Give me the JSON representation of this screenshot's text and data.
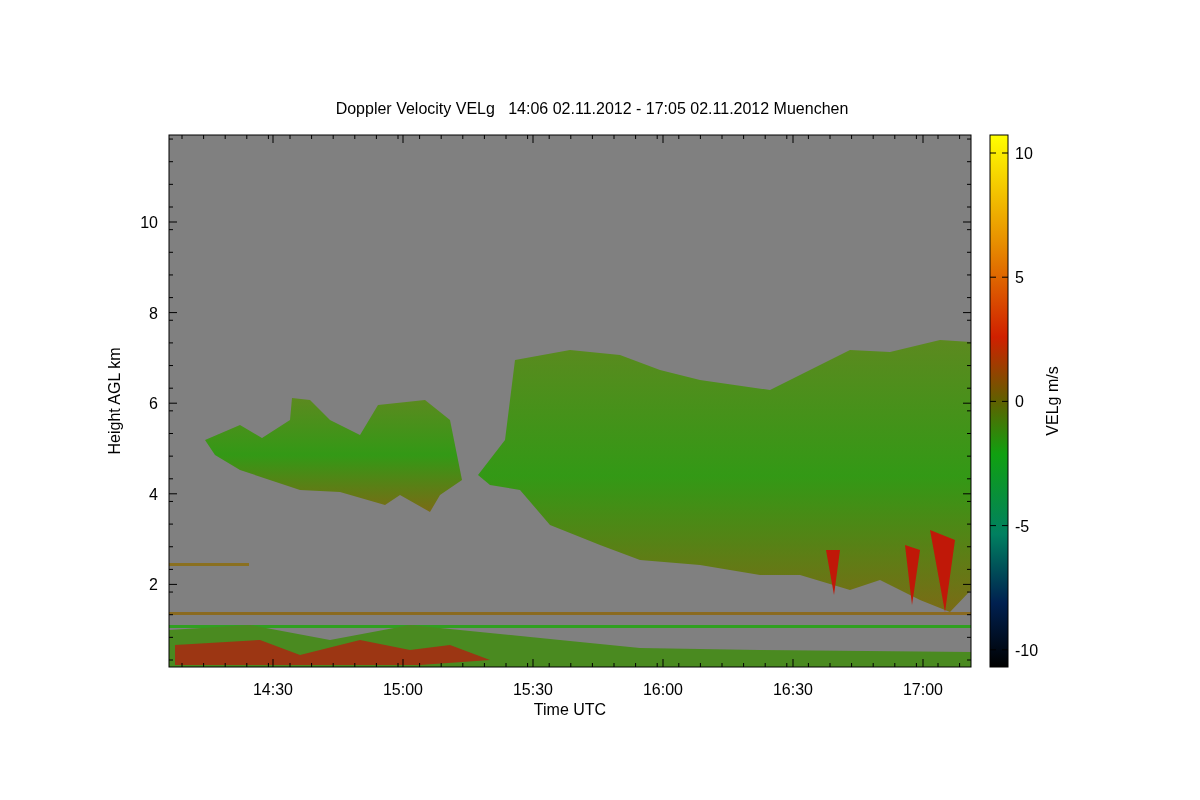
{
  "plot": {
    "title": "Doppler Velocity VELg   14:06 02.11.2012 - 17:05 02.11.2012 Muenchen",
    "xlabel": "Time UTC",
    "ylabel": "Height AGL km",
    "xticks": [
      "14:30",
      "15:00",
      "15:30",
      "16:00",
      "16:30",
      "17:00"
    ],
    "yticks": [
      "10",
      "8",
      "6",
      "4",
      "2"
    ],
    "colorbar": {
      "label": "VELg m/s",
      "ticks": [
        "10",
        "5",
        "0",
        "-5",
        "-10"
      ]
    }
  }
}
